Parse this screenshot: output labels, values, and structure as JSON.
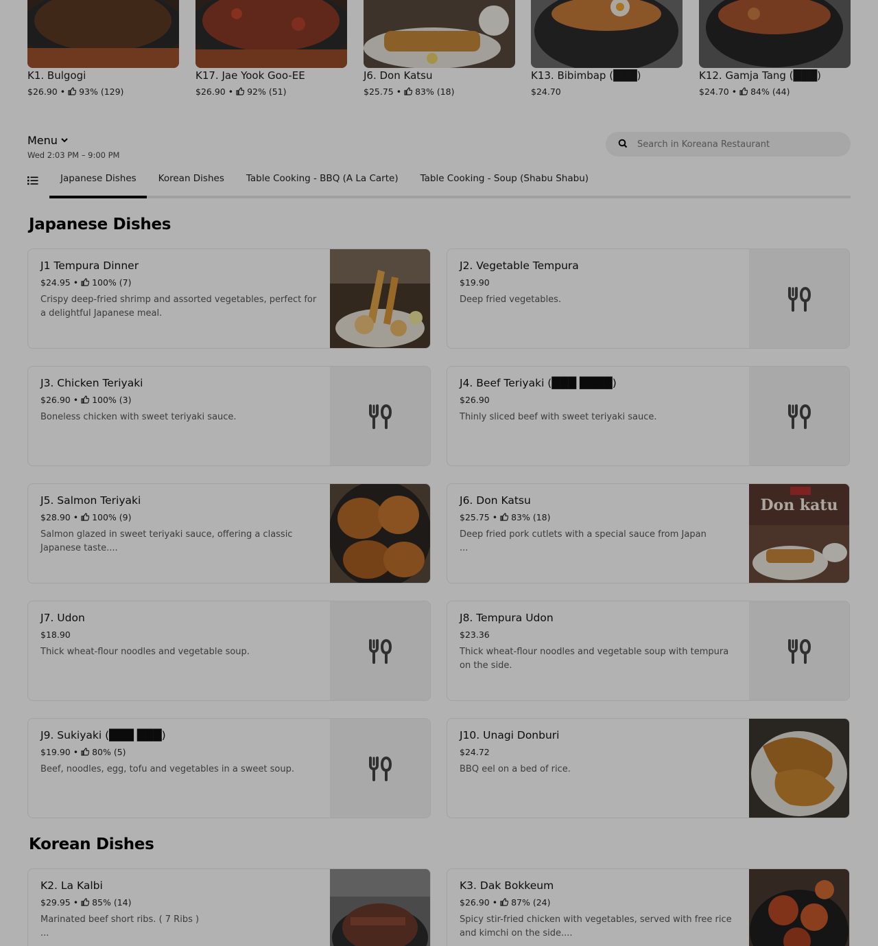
{
  "featured": [
    {
      "name": "K1. Bulgogi",
      "price": "$26.90",
      "rating": "93% (129)",
      "image": "sizzling-beef-plate"
    },
    {
      "name": "K17. Jae Yook Goo-EE",
      "price": "$26.90",
      "rating": "92% (51)",
      "image": "spicy-pork-plate"
    },
    {
      "name": "J6. Don Katsu",
      "price": "$25.75",
      "rating": "83% (18)",
      "image": "pork-cutlet-plate"
    },
    {
      "name": "K13. Bibimbap (███)",
      "price": "$24.70",
      "rating": "",
      "image": "stone-bowl-bibimbap"
    },
    {
      "name": "K12. Gamja Tang (███)",
      "price": "$24.70",
      "rating": "84% (44)",
      "image": "stew-pot"
    }
  ],
  "menu": {
    "title": "Menu",
    "hours": "Wed 2:03 PM – 9:00 PM"
  },
  "search": {
    "placeholder": "Search in Koreana Restaurant"
  },
  "tabs": [
    {
      "label": "Japanese Dishes",
      "active": true
    },
    {
      "label": "Korean Dishes",
      "active": false
    },
    {
      "label": "Table Cooking - BBQ (A La Carte)",
      "active": false
    },
    {
      "label": "Table Cooking - Soup (Shabu Shabu)",
      "active": false
    }
  ],
  "sections": [
    {
      "title": "Japanese Dishes",
      "items": [
        {
          "name": "J1 Tempura Dinner",
          "price": "$24.95",
          "rating": "100% (7)",
          "description": "Crispy deep-fried shrimp and assorted vegetables, perfect for a delightful Japanese meal.",
          "image": "tempura"
        },
        {
          "name": "J2. Vegetable Tempura",
          "price": "$19.90",
          "rating": "",
          "description": "Deep fried vegetables.",
          "image": "placeholder"
        },
        {
          "name": "J3. Chicken Teriyaki",
          "price": "$26.90",
          "rating": "100% (3)",
          "description": "Boneless chicken with sweet teriyaki sauce.",
          "image": "placeholder"
        },
        {
          "name": "J4. Beef Teriyaki (███ ████)",
          "price": "$26.90",
          "rating": "",
          "description": "Thinly sliced beef with sweet teriyaki sauce.",
          "image": "placeholder"
        },
        {
          "name": "J5. Salmon Teriyaki",
          "price": "$28.90",
          "rating": "100% (9)",
          "description": "Salmon glazed in sweet teriyaki sauce, offering a classic Japanese taste....",
          "image": "salmon"
        },
        {
          "name": "J6. Don Katsu",
          "price": "$25.75",
          "rating": "83% (18)",
          "description": "Deep fried pork cutlets with a special sauce from Japan\n...",
          "image": "donkatsu",
          "image_text": "Don katu"
        },
        {
          "name": "J7. Udon",
          "price": "$18.90",
          "rating": "",
          "description": "Thick wheat-flour noodles and vegetable soup.",
          "image": "placeholder"
        },
        {
          "name": "J8. Tempura Udon",
          "price": "$23.36",
          "rating": "",
          "description": "Thick wheat-flour noodles and vegetable soup with tempura on the side.",
          "image": "placeholder"
        },
        {
          "name": "J9. Sukiyaki (███ ███)",
          "price": "$19.90",
          "rating": "80% (5)",
          "description": "Beef, noodles, egg, tofu and vegetables in a sweet soup.",
          "image": "placeholder"
        },
        {
          "name": "J10. Unagi Donburi",
          "price": "$24.72",
          "rating": "",
          "description": "BBQ eel on a bed of rice.",
          "image": "unagi"
        }
      ]
    },
    {
      "title": "Korean Dishes",
      "items": [
        {
          "name": "K2. La Kalbi",
          "price": "$29.95",
          "rating": "85% (14)",
          "description": "Marinated beef short ribs. ( 7 Ribs )\n...",
          "image": "kalbi"
        },
        {
          "name": "K3. Dak Bokkeum",
          "price": "$26.90",
          "rating": "87% (24)",
          "description": "Spicy stir-fried chicken with vegetables, served with free rice and kimchi on the side....",
          "image": "dak"
        }
      ]
    }
  ],
  "colors": {
    "active_tab": "#000000",
    "overlay": "rgba(0,0,0,0.3)"
  }
}
